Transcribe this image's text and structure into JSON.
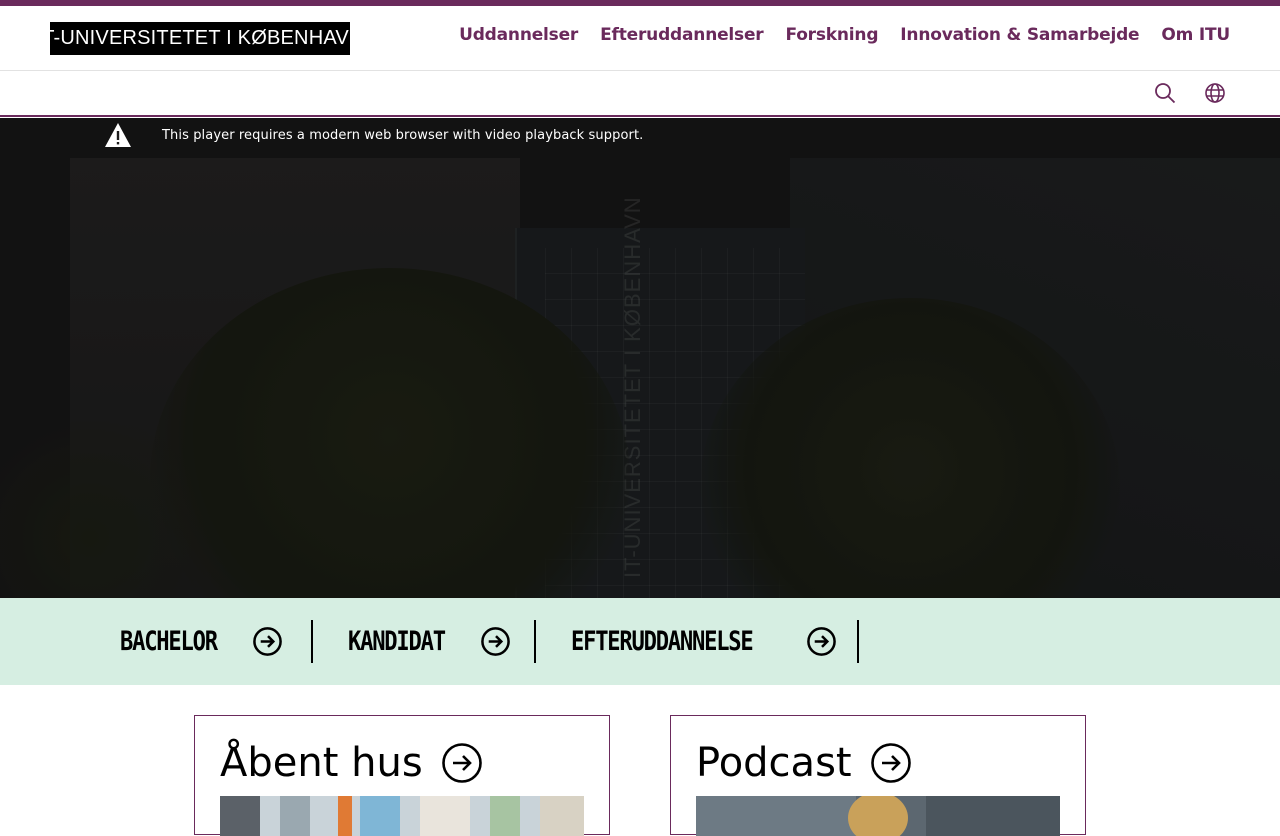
{
  "header": {
    "logo_text": "IT-UNIVERSITETET I KØBENHAVN",
    "nav": [
      "Uddannelser",
      "Efteruddannelser",
      "Forskning",
      "Innovation & Samarbejde",
      "Om ITU"
    ]
  },
  "utility": {
    "search_icon": "search-icon",
    "language_icon": "globe-icon"
  },
  "hero": {
    "player_message": "This player requires a modern web browser with video playback support.",
    "building_text": "IT-UNIVERSITETET I KØBENHAVN"
  },
  "programs": [
    "BACHELOR",
    "KANDIDAT",
    "EFTERUDDANNELSE"
  ],
  "cards": [
    {
      "title": "Åbent hus"
    },
    {
      "title": "Podcast"
    }
  ],
  "colors": {
    "brand": "#6a2a5c",
    "programs_bg": "#d6eee2"
  }
}
